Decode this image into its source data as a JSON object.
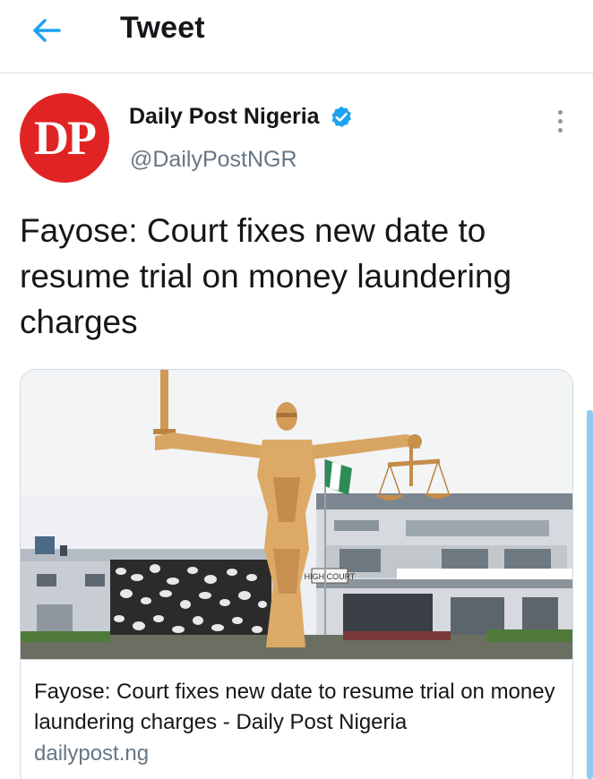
{
  "header": {
    "back_icon": "arrow-left-icon",
    "title": "Tweet"
  },
  "author": {
    "avatar_text": "DP",
    "avatar_color": "#e02424",
    "name": "Daily Post Nigeria",
    "verified_icon": "verified-badge-icon",
    "handle": "@DailyPostNGR",
    "more_icon": "more-vertical-icon"
  },
  "tweet": {
    "text": "Fayose: Court fixes new date to resume trial on money laundering charges"
  },
  "card": {
    "image_signage": "HIGH COURT",
    "title": "Fayose: Court fixes new date to resume trial on money laundering charges - Daily Post Nigeria",
    "domain": "dailypost.ng"
  },
  "colors": {
    "accent": "#1da1f2",
    "text_primary": "#14171a",
    "text_secondary": "#657786"
  }
}
